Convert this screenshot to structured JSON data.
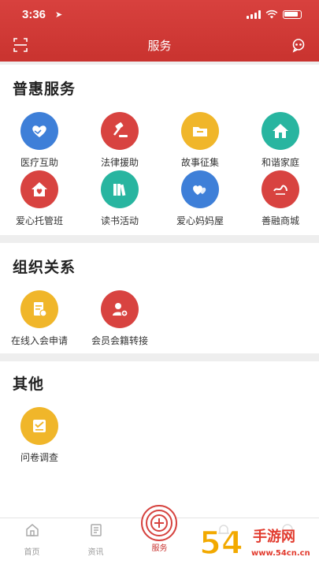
{
  "status": {
    "time": "3:36"
  },
  "nav": {
    "title": "服务",
    "left_icon": "scan-icon",
    "right_icon": "message-icon"
  },
  "colors": {
    "brand": "#c9332f",
    "tab_active": "#c9332f"
  },
  "sections": [
    {
      "title": "普惠服务",
      "items": [
        {
          "label": "医疗互助",
          "icon": "handshake-heart-icon",
          "color": "#3e7fd8"
        },
        {
          "label": "法律援助",
          "icon": "gavel-icon",
          "color": "#d84340"
        },
        {
          "label": "故事征集",
          "icon": "folder-icon",
          "color": "#f0b62a"
        },
        {
          "label": "和谐家庭",
          "icon": "house-icon",
          "color": "#28b5a0"
        },
        {
          "label": "爱心托管班",
          "icon": "heart-house-icon",
          "color": "#d84340"
        },
        {
          "label": "读书活动",
          "icon": "books-icon",
          "color": "#28b5a0"
        },
        {
          "label": "爱心妈妈屋",
          "icon": "hearts-icon",
          "color": "#3e7fd8"
        },
        {
          "label": "善融商城",
          "icon": "shop-logo-icon",
          "color": "#d84340"
        }
      ]
    },
    {
      "title": "组织关系",
      "items": [
        {
          "label": "在线入会申请",
          "icon": "application-form-icon",
          "color": "#f0b62a"
        },
        {
          "label": "会员会籍转接",
          "icon": "member-transfer-icon",
          "color": "#d84340"
        }
      ]
    },
    {
      "title": "其他",
      "items": [
        {
          "label": "问卷调查",
          "icon": "survey-icon",
          "color": "#f0b62a"
        }
      ]
    }
  ],
  "tabbar": {
    "home": "首页",
    "news": "资讯",
    "service": "服务"
  },
  "watermark": {
    "line1": "手游网",
    "line2": "www.54cn.cn",
    "logo": "54"
  }
}
